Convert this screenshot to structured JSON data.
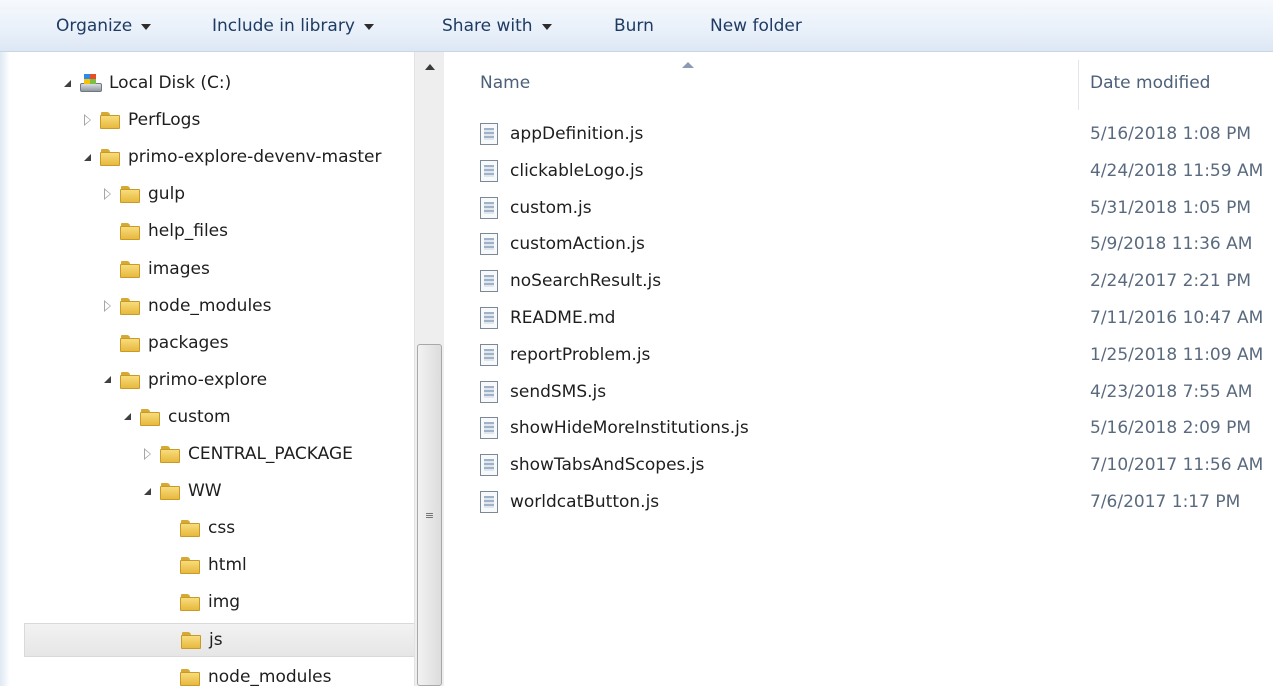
{
  "toolbar": {
    "organize": "Organize",
    "include_in_library": "Include in library",
    "share_with": "Share with",
    "burn": "Burn",
    "new_folder": "New folder"
  },
  "tree": [
    {
      "label": "Local Disk (C:)",
      "icon": "drive-icon",
      "state": "expanded",
      "level": 0
    },
    {
      "label": "PerfLogs",
      "icon": "folder-icon",
      "state": "collapsed",
      "level": 1
    },
    {
      "label": "primo-explore-devenv-master",
      "icon": "folder-icon",
      "state": "expanded",
      "level": 1
    },
    {
      "label": "gulp",
      "icon": "folder-icon",
      "state": "collapsed",
      "level": 2
    },
    {
      "label": "help_files",
      "icon": "folder-icon",
      "state": "none",
      "level": 2
    },
    {
      "label": "images",
      "icon": "folder-icon",
      "state": "none",
      "level": 2
    },
    {
      "label": "node_modules",
      "icon": "folder-icon",
      "state": "collapsed",
      "level": 2
    },
    {
      "label": "packages",
      "icon": "folder-icon",
      "state": "none",
      "level": 2
    },
    {
      "label": "primo-explore",
      "icon": "folder-icon",
      "state": "expanded",
      "level": 2
    },
    {
      "label": "custom",
      "icon": "folder-icon",
      "state": "expanded",
      "level": 3
    },
    {
      "label": "CENTRAL_PACKAGE",
      "icon": "folder-icon",
      "state": "collapsed",
      "level": 4
    },
    {
      "label": "WW",
      "icon": "folder-icon",
      "state": "expanded",
      "level": 4
    },
    {
      "label": "css",
      "icon": "folder-icon",
      "state": "none",
      "level": 5
    },
    {
      "label": "html",
      "icon": "folder-icon",
      "state": "none",
      "level": 5
    },
    {
      "label": "img",
      "icon": "folder-icon",
      "state": "none",
      "level": 5
    },
    {
      "label": "js",
      "icon": "folder-icon",
      "state": "none",
      "level": 5,
      "selected": true
    },
    {
      "label": "node_modules",
      "icon": "folder-icon",
      "state": "none",
      "level": 5
    }
  ],
  "columns": {
    "name": "Name",
    "date_modified": "Date modified"
  },
  "files": [
    {
      "name": "appDefinition.js",
      "date": "5/16/2018 1:08 PM"
    },
    {
      "name": "clickableLogo.js",
      "date": "4/24/2018 11:59 AM"
    },
    {
      "name": "custom.js",
      "date": "5/31/2018 1:05 PM"
    },
    {
      "name": "customAction.js",
      "date": "5/9/2018 11:36 AM"
    },
    {
      "name": "noSearchResult.js",
      "date": "2/24/2017 2:21 PM"
    },
    {
      "name": "README.md",
      "date": "7/11/2016 10:47 AM"
    },
    {
      "name": "reportProblem.js",
      "date": "1/25/2018 11:09 AM"
    },
    {
      "name": "sendSMS.js",
      "date": "4/23/2018 7:55 AM"
    },
    {
      "name": "showHideMoreInstitutions.js",
      "date": "5/16/2018 2:09 PM"
    },
    {
      "name": "showTabsAndScopes.js",
      "date": "7/10/2017 11:56 AM"
    },
    {
      "name": "worldcatButton.js",
      "date": "7/6/2017 1:17 PM"
    }
  ],
  "scrollbar": {
    "grip": "≡"
  }
}
